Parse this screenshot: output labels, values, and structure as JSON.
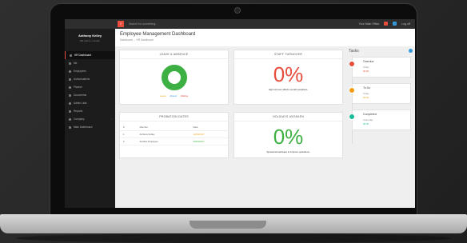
{
  "topbar": {
    "menu_icon": "menu-icon",
    "search_placeholder": "Search for something...",
    "office": "Your Main Office",
    "logout": "Log off"
  },
  "profile": {
    "name": "Anthony Kelley",
    "role": "HR Admin, London"
  },
  "sidebar": {
    "items": [
      {
        "label": "HR Dashboard",
        "active": true,
        "arrow": false
      },
      {
        "label": "Me",
        "active": false,
        "arrow": false
      },
      {
        "label": "Employees",
        "active": false,
        "arrow": false
      },
      {
        "label": "Authorisations",
        "active": false,
        "arrow": false
      },
      {
        "label": "Planner",
        "active": false,
        "arrow": false
      },
      {
        "label": "Documents",
        "active": false,
        "arrow": false
      },
      {
        "label": "Admin Lists",
        "active": false,
        "arrow": false
      },
      {
        "label": "Reports",
        "active": false,
        "arrow": false
      },
      {
        "label": "Company",
        "active": false,
        "arrow": true
      },
      {
        "label": "Main Dashboard",
        "active": false,
        "arrow": false
      }
    ]
  },
  "page": {
    "title": "Employee Management Dashboard",
    "breadcrumb": "Dashboard → HR Dashboard"
  },
  "cards": {
    "leave": {
      "title": "LEAVE & ABSENCE",
      "legend": [
        "Leave",
        "Absent",
        "Waiting"
      ],
      "donut_color": "#3cb043"
    },
    "turnover": {
      "title": "STAFF TURNOVER",
      "value": "0%",
      "sub": "High turnover affects overall operations.",
      "color": "#e74c3c"
    },
    "probation": {
      "title": "PROBATION DATES",
      "headers": [
        "#",
        "Member",
        "Date"
      ],
      "rows": [
        [
          "1",
          "Anthony Kelley",
          "12/03/2017"
        ],
        [
          "2",
          "Another Employee",
          "09/04/2017"
        ]
      ]
    },
    "holidays": {
      "title": "HOLIDAYS UNTAKEN",
      "value": "0%",
      "sub": "Spread annual leave to improve operations.",
      "color": "#3cb043"
    }
  },
  "tasks": {
    "title": "Tasks",
    "items": [
      {
        "label": "Overdue",
        "when": "Today",
        "count": "00:00",
        "color": "#e74c3c"
      },
      {
        "label": "To Do",
        "when": "Today",
        "count": "00:00",
        "color": "#f39c12"
      },
      {
        "label": "Completed",
        "when": "Yesterday",
        "count": "00:00",
        "color": "#1abc9c"
      }
    ]
  }
}
